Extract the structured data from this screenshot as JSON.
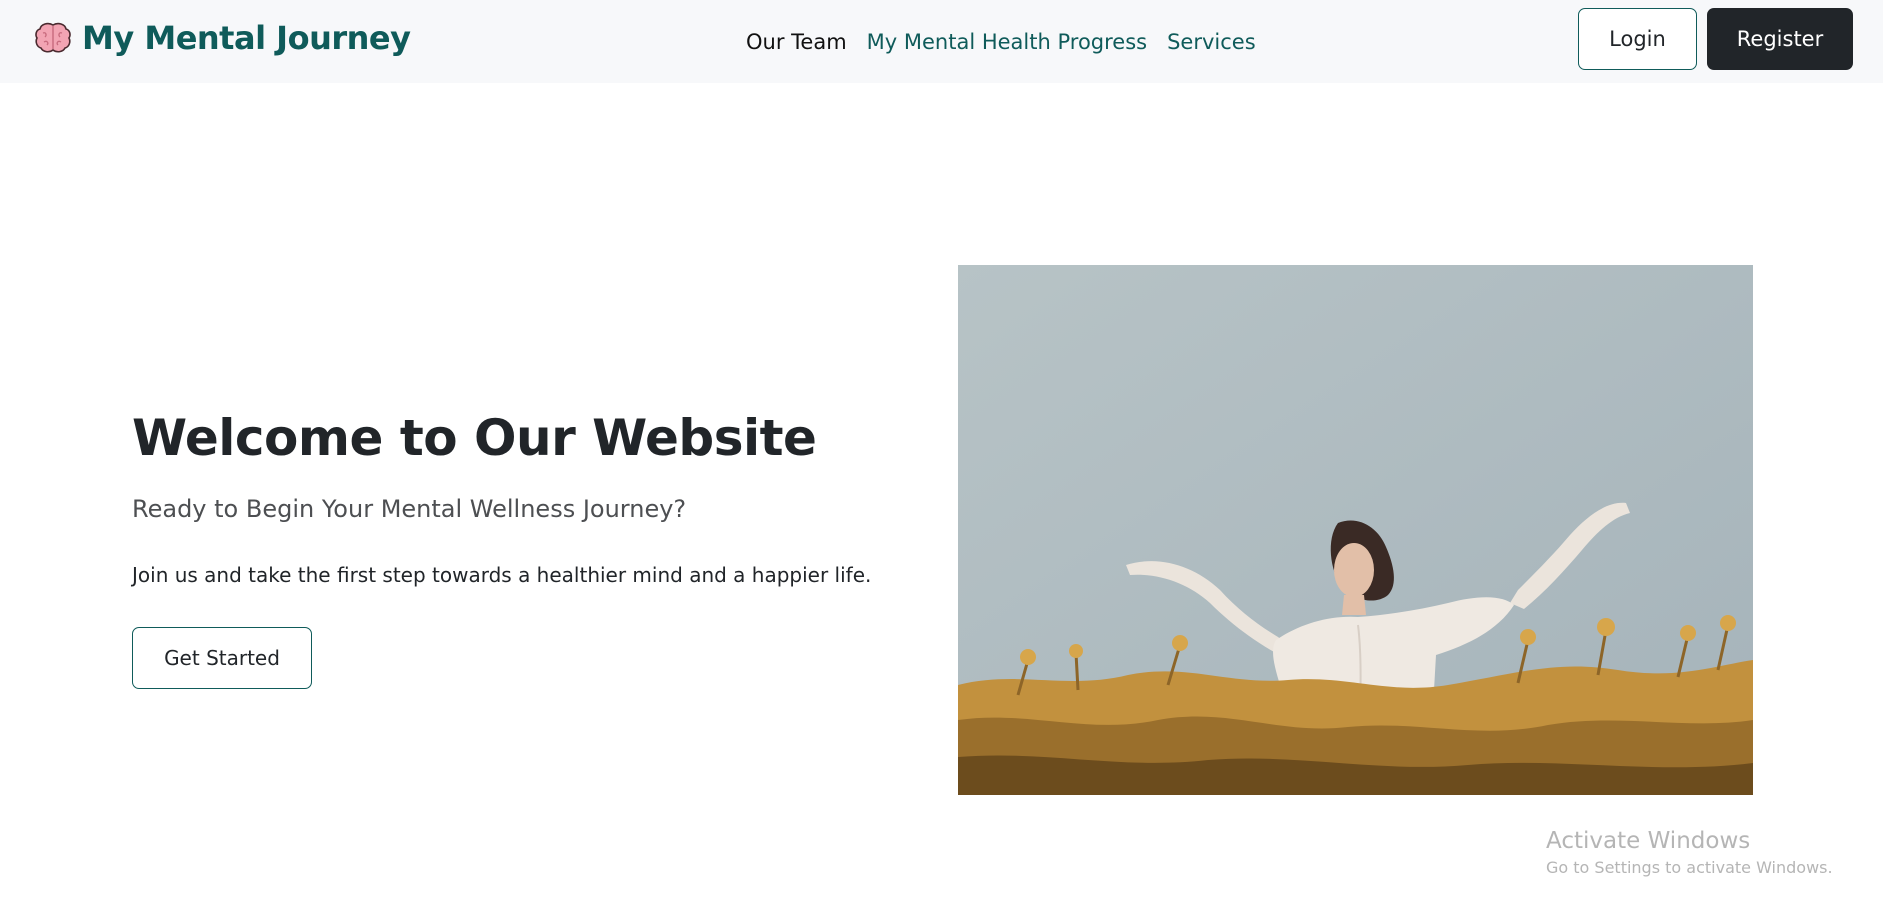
{
  "brand": {
    "name": "My Mental Journey",
    "icon": "brain-icon"
  },
  "nav": {
    "items": [
      {
        "label": "Our Team",
        "active": true
      },
      {
        "label": "My Mental Health Progress",
        "active": false
      },
      {
        "label": "Services",
        "active": false
      }
    ]
  },
  "auth": {
    "login_label": "Login",
    "register_label": "Register"
  },
  "hero": {
    "title": "Welcome to Our Website",
    "subtitle": "Ready to Begin Your Mental Wellness Journey?",
    "description": "Join us and take the first step towards a healthier mind and a happier life.",
    "cta_label": "Get Started"
  },
  "watermark": {
    "title": "Activate Windows",
    "subtitle": "Go to Settings to activate Windows."
  },
  "colors": {
    "brand_teal": "#0f5b5a",
    "dark": "#212529",
    "navbar_bg": "#f7f8fa"
  }
}
